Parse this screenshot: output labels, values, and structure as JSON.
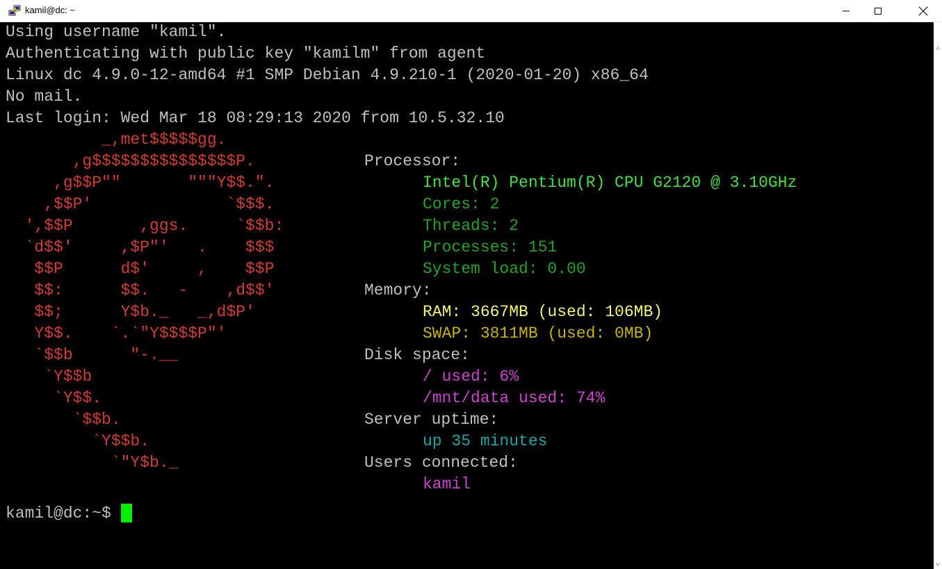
{
  "window": {
    "title": "kamil@dc: ~",
    "icons": {
      "app": "putty-icon",
      "minimize": "minimize-icon",
      "maximize": "maximize-icon",
      "close": "close-icon"
    }
  },
  "terminal": {
    "login": [
      "Using username \"kamil\".",
      "Authenticating with public key \"kamilm\" from agent",
      "Linux dc 4.9.0-12-amd64 #1 SMP Debian 4.9.210-1 (2020-01-20) x86_64",
      "No mail.",
      "Last login: Wed Mar 18 08:29:13 2020 from 10.5.32.10"
    ],
    "logo": [
      "          _,met$$$$$gg.",
      "       ,g$$$$$$$$$$$$$$$P.",
      "     ,g$$P\"\"       \"\"\"Y$$.\".",
      "    ,$$P'              `$$$.",
      "  ',$$P       ,ggs.     `$$b:",
      "  `d$$'     ,$P\"'   .    $$$",
      "   $$P      d$'     ,    $$P",
      "   $$:      $$.   -    ,d$$'",
      "   $$;      Y$b._   _,d$P'",
      "   Y$$.    `.`\"Y$$$$P\"'",
      "   `$$b      \"-.__",
      "    `Y$$b",
      "     `Y$$.",
      "       `$$b.",
      "         `Y$$b.",
      "           `\"Y$b._"
    ],
    "info": {
      "processor_label": "Processor:",
      "cpu": "Intel(R) Pentium(R) CPU G2120 @ 3.10GHz",
      "cores": "Cores: 2",
      "threads": "Threads: 2",
      "processes": "Processes: 151",
      "load": "System load: 0.00",
      "memory_label": "Memory:",
      "ram": "RAM: 3667MB (used: 106MB)",
      "swap": "SWAP: 3811MB (used: 0MB)",
      "disk_label": "Disk space:",
      "disk_root": "/ used: 6%",
      "disk_data": "/mnt/data used: 74%",
      "uptime_label": "Server uptime:",
      "uptime": "up 35 minutes",
      "users_label": "Users connected:",
      "users": "kamil"
    },
    "prompt": "kamil@dc:~$ ",
    "colors": {
      "default": "#c0c0c0",
      "logo": "#d63a2f",
      "cpu": "#3ee43e",
      "cpu_detail": "#1fa51f",
      "ram": "#f4f46b",
      "swap": "#c8b400",
      "disk": "#d040d0",
      "uptime": "#14a8a8",
      "users": "#d040d0",
      "cursor": "#00f000"
    }
  }
}
